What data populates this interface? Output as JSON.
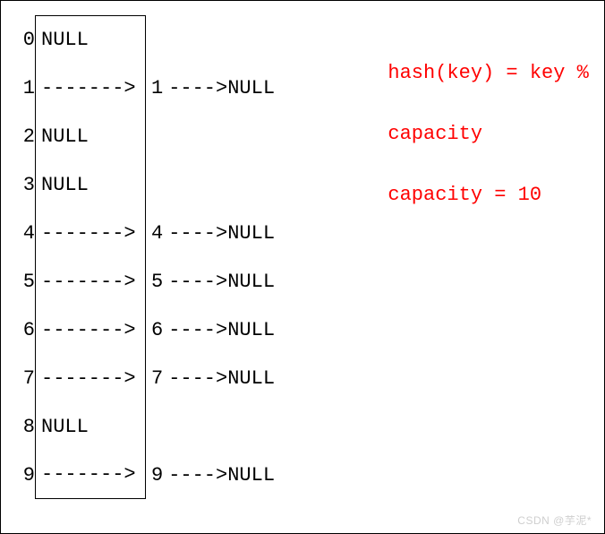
{
  "formula": {
    "line1": "hash(key) = key %",
    "line2": "capacity",
    "line3": "capacity = 10"
  },
  "arrow_bucket": "------->",
  "arrow_chain": "---->",
  "null_label": "NULL",
  "buckets": [
    {
      "index": "0",
      "type": "null"
    },
    {
      "index": "1",
      "type": "chain",
      "value": "1"
    },
    {
      "index": "2",
      "type": "null"
    },
    {
      "index": "3",
      "type": "null"
    },
    {
      "index": "4",
      "type": "chain",
      "value": "4"
    },
    {
      "index": "5",
      "type": "chain",
      "value": "5"
    },
    {
      "index": "6",
      "type": "chain",
      "value": "6"
    },
    {
      "index": "7",
      "type": "chain",
      "value": "7"
    },
    {
      "index": "8",
      "type": "null"
    },
    {
      "index": "9",
      "type": "chain",
      "value": "9"
    }
  ],
  "watermark": "CSDN @芋泥*"
}
